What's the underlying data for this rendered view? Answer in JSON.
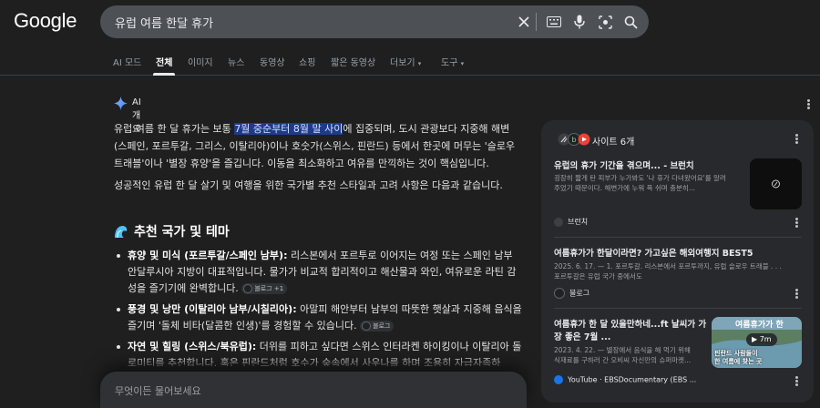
{
  "header": {
    "logo": "Google",
    "query": "유럽 여름 한달 휴가",
    "icons": [
      "close-icon",
      "keyboard-icon",
      "mic-icon",
      "lens-icon",
      "search-icon"
    ]
  },
  "tabs": {
    "ai_mode": "AI 모드",
    "all": "전체",
    "images": "이미지",
    "news": "뉴스",
    "videos": "동영상",
    "shopping": "쇼핑",
    "short_videos": "짧은 동영상",
    "more": "더보기",
    "tools": "도구"
  },
  "ai_overview": {
    "label": "AI 개요",
    "p1_a": "유럽 여름 한 달 휴가는 보통 ",
    "p1_hl": "7월 중순부터 8월 말 사이",
    "p1_b": "에 집중되며, 도시 관광보다 지중해 해변(스페인, 포르투갈, 그리스, 이탈리아)이나 호숫가(스위스, 핀란드) 등에서 한곳에 머무는 '슬로우 트래블'이나 '별장 휴양'을 즐깁니다. 이동을 최소화하고 여유를 만끽하는 것이 핵심입니다.",
    "p2": "성공적인 유럽 한 달 살기 및 여행을 위한 국가별 추천 스타일과 고려 사항은 다음과 같습니다.",
    "section_title": "추천 국가 및 테마",
    "bullets": [
      {
        "bold": "휴양 및 미식 (포르투갈/스페인 남부):",
        "text": " 리스본에서 포르투로 이어지는 여정 또는 스페인 남부 안달루시아 지방이 대표적입니다. 물가가 비교적 합리적이고 해산물과 와인, 여유로운 라틴 감성을 즐기기에 완벽합니다. ",
        "chip": "블로그 +1"
      },
      {
        "bold": "풍경 및 낭만 (이탈리아 남부/시칠리아):",
        "text": " 아말피 해안부터 남부의 따뜻한 햇살과 지중해 음식을 즐기며 '돌체 비타(달콤한 인생)'를 경험할 수 있습니다. ",
        "chip": "블로그"
      },
      {
        "bold": "자연 및 힐링 (스위스/북유럽):",
        "text": " 더위를 피하고 싶다면 스위스 인터라켄 하이킹이나 이탈리아 돌로미티를 추천합니다. 혹은 핀란드처럼 호수가 숲속에서 사우나를 하며 조용히 자급자족하",
        "chip": ""
      }
    ],
    "ask_placeholder": "무엇이든 물어보세요"
  },
  "sources": {
    "count_label": "사이트 6개",
    "items": [
      {
        "title": "유럽의 휴가 기간을 겪으며... - 브런치",
        "snippet_1": "굉장히 짧게 탄 피부가 누가봐도 '나 휴가 다녀왔어요'를 알려",
        "snippet_2": "주었기 때문이다. 해변가에 누워 푹 쉬며 충분히...",
        "source": "브런치",
        "fav_color": "#3c4043"
      },
      {
        "title": "여름휴가가 한달이라면? 가고싶은 해외여행지 BEST5",
        "snippet_1": "2025. 6. 17. — 1. 포르투갈. 리스본에서 포르투까지, 유럽 슬로우 트래블 . . .",
        "snippet_2": "포르투갈은 유럽 국가 중에서도",
        "source": "블로그",
        "fav_color": "#202124"
      },
      {
        "title_1": "여름휴가 한 달 있을만하네...ft 날씨가 가",
        "title_2": "장 좋은 7월 ...",
        "snippet_1": "2023. 4. 22. — 별장에서 음식을 해 먹기 위해",
        "snippet_2": "식재료를 구하러 간 오비씨 자신만의 슈퍼마켓...",
        "source": "YouTube · EBSDocumentary (EBS ...",
        "video_caption": "여름휴가가 한",
        "video_sub_1": "핀란드 사람들이",
        "video_sub_2": "한 여름에 찾는 곳",
        "duration": "7m"
      }
    ]
  }
}
